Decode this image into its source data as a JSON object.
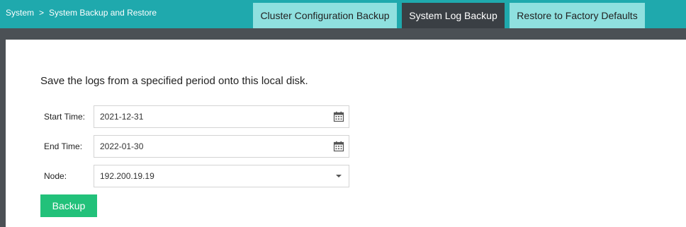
{
  "breadcrumb": {
    "root": "System",
    "separator": ">",
    "current": "System Backup and Restore"
  },
  "tabs": [
    {
      "label": "Cluster Configuration Backup",
      "active": false
    },
    {
      "label": "System Log Backup",
      "active": true
    },
    {
      "label": "Restore to Factory Defaults",
      "active": false
    }
  ],
  "form": {
    "description": "Save the logs from a specified period onto this local disk.",
    "start_time": {
      "label": "Start Time:",
      "value": "2021-12-31",
      "icon": "calendar-icon"
    },
    "end_time": {
      "label": "End Time:",
      "value": "2022-01-30",
      "icon": "calendar-icon"
    },
    "node": {
      "label": "Node:",
      "value": "192.200.19.19",
      "icon": "chevron-down-icon"
    },
    "backup_label": "Backup"
  },
  "colors": {
    "header": "#1fa9ad",
    "tab_inactive": "#8fe0df",
    "tab_active": "#3a3f44",
    "backup_button": "#22c17a",
    "background": "#4b5055"
  }
}
